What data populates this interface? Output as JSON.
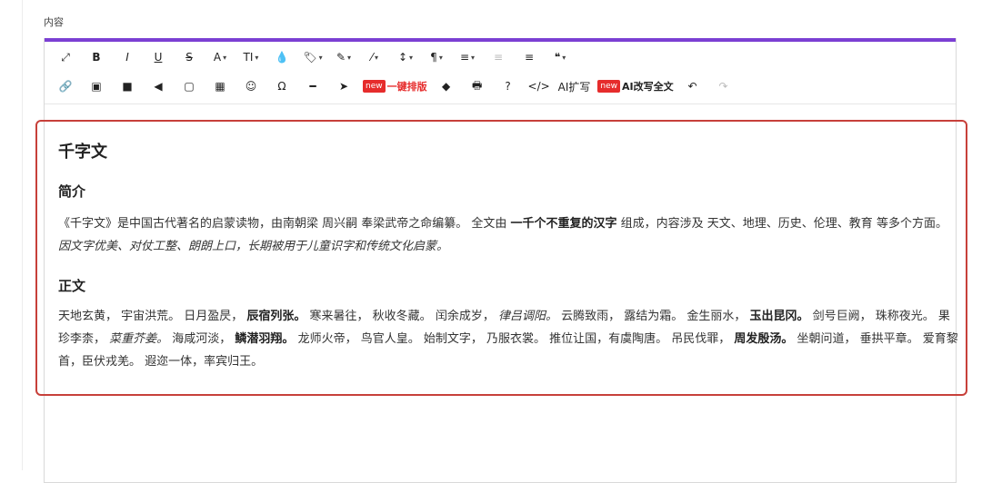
{
  "field_label": "内容",
  "toolbar": {
    "row1": [
      {
        "name": "fullscreen-icon",
        "glyph": "⤢"
      },
      {
        "name": "bold-button",
        "glyph": "B"
      },
      {
        "name": "italic-button",
        "glyph": "I"
      },
      {
        "name": "underline-button",
        "glyph": "U"
      },
      {
        "name": "strikethrough-button",
        "glyph": "S"
      },
      {
        "name": "font-color-button",
        "glyph": "A",
        "caret": true
      },
      {
        "name": "font-size-button",
        "glyph": "TI",
        "caret": true
      },
      {
        "name": "background-color-icon",
        "glyph": "💧"
      },
      {
        "name": "tag-icon",
        "glyph": "🏷",
        "caret": true
      },
      {
        "name": "brush-icon",
        "glyph": "✎",
        "caret": true
      },
      {
        "name": "magic-wand-icon",
        "glyph": "⁄",
        "caret": true
      },
      {
        "name": "line-height-icon",
        "glyph": "↕",
        "caret": true
      },
      {
        "name": "paragraph-icon",
        "glyph": "¶",
        "caret": true
      },
      {
        "name": "align-icon",
        "glyph": "≡",
        "caret": true
      },
      {
        "name": "outdent-icon",
        "glyph": "≡",
        "light": true
      },
      {
        "name": "indent-icon",
        "glyph": "≡"
      },
      {
        "name": "quote-icon",
        "glyph": "❝",
        "caret": true
      }
    ],
    "row2": {
      "link": "🔗",
      "image": "▣",
      "video": "■",
      "audio": "◀",
      "file": "▢",
      "table": "▦",
      "emoji": "☺",
      "omega": "Ω",
      "hr": "━",
      "cursor": "➤",
      "new_badge_1": "new",
      "onekey_layout": "一键排版",
      "eraser": "◆",
      "print": "🖶",
      "help": "?",
      "code": "</>",
      "ai_expand": "AI扩写",
      "new_badge_2": "new",
      "ai_rewrite": "AI改写全文",
      "undo": "↶",
      "redo": "↷"
    }
  },
  "content": {
    "title": "千字文",
    "intro_heading": "简介",
    "intro": {
      "t1": "《千字文》是中国古代著名的启蒙读物，由南朝梁 周兴嗣 奉梁武帝之命编纂。 全文由 ",
      "b1": "一千个不重复的汉字",
      "t2": " 组成，内容涉及 天文、地理、历史、伦理、教育 等多个方面。 ",
      "i1": "因文字优美、对仗工整、朗朗上口，长期被用于儿童识字和传统文化启蒙。"
    },
    "body_heading": "正文",
    "body": {
      "t1": "天地玄黄， 宇宙洪荒。 日月盈昃， ",
      "b1": "辰宿列张。",
      "t2": " 寒来暑往， 秋收冬藏。 闰余成岁， ",
      "i1": "律吕调阳。",
      "t3": " 云腾致雨， 露结为霜。 金生丽水， ",
      "b2": "玉出昆冈。",
      "t4": " 剑号巨阙， 珠称夜光。 果珍李柰， ",
      "i2": "菜重芥姜。",
      "t5": " 海咸河淡， ",
      "b3": "鳞潜羽翔。",
      "t6": " 龙师火帝， 鸟官人皇。 始制文字， 乃服衣裳。 推位让国，有虞陶唐。 吊民伐罪， ",
      "b4": "周发殷汤。",
      "t7": " 坐朝问道， 垂拱平章。 爱育黎首，臣伏戎羌。 遐迩一体，率宾归王。"
    }
  },
  "colors": {
    "accent_bar": "#7b3fd3",
    "highlight_border": "#c7403a",
    "badge_red": "#e62c2c"
  }
}
